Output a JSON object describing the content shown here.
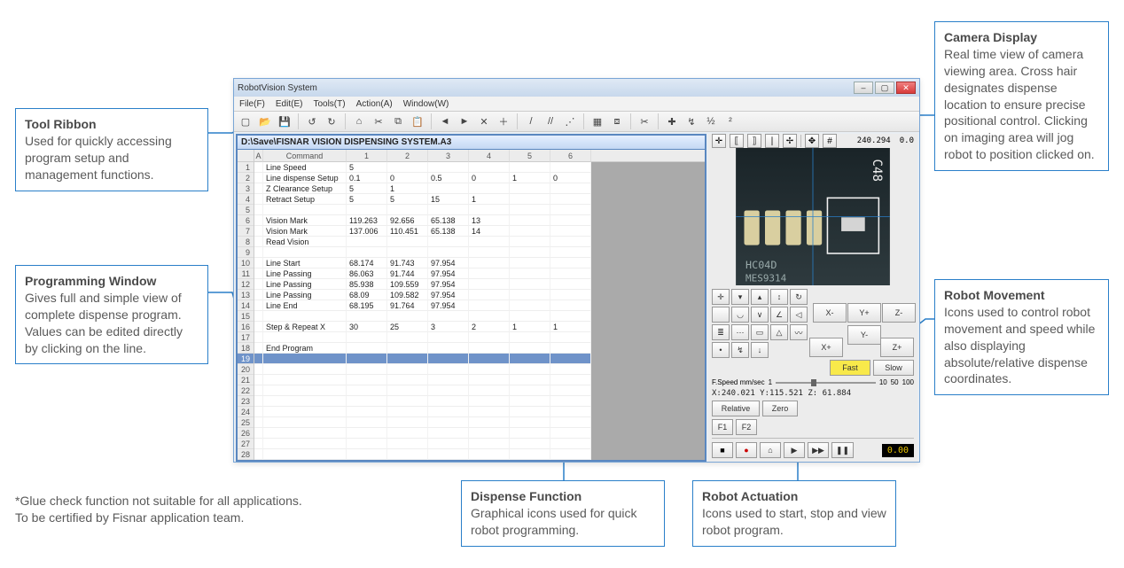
{
  "callouts": {
    "tool_ribbon": {
      "title": "Tool Ribbon",
      "body": "Used for quickly accessing program setup and management functions."
    },
    "programming_window": {
      "title": "Programming Window",
      "body": "Gives full and simple view of complete dispense program. Values can be edited directly by clicking on the line."
    },
    "camera_display": {
      "title": "Camera Display",
      "body": "Real time view of camera viewing area. Cross hair designates dispense location to ensure precise positional control. Clicking on imaging area will jog robot to position clicked on."
    },
    "robot_movement": {
      "title": "Robot Movement",
      "body": "Icons used to control robot movement and speed while also displaying absolute/relative dispense coordinates."
    },
    "dispense_function": {
      "title": "Dispense Function",
      "body": "Graphical icons used for quick robot programming."
    },
    "robot_actuation": {
      "title": "Robot Actuation",
      "body": "Icons used to start, stop and view robot program."
    }
  },
  "footnote": "*Glue check function not suitable for all applications. To be certified by Fisnar application team.",
  "app": {
    "title": "RobotVision System",
    "menus": [
      "File(F)",
      "Edit(E)",
      "Tools(T)",
      "Action(A)",
      "Window(W)"
    ],
    "ribbon_icons": [
      "new",
      "open",
      "save",
      "sep",
      "undo",
      "redo",
      "sep",
      "home",
      "cut",
      "copy",
      "paste",
      "sep",
      "arrow-left",
      "arrow-right",
      "close-x",
      "plus",
      "sep",
      "slash",
      "double-slash",
      "slash-nodes",
      "sep",
      "grid",
      "s-r",
      "sep",
      "scissors",
      "sep",
      "cross",
      "path",
      "1-2",
      "2-1"
    ],
    "topjog_icons": [
      "target",
      "bracket-in",
      "bracket-out",
      "divider",
      "crosshair",
      "sep",
      "xy-icon",
      "coord",
      "gap"
    ],
    "topjog_coord": "240.294",
    "topjog_extra": "0.0",
    "prog_title": "D:\\Save\\FISNAR VISION DISPENSING SYSTEM.A3",
    "grid": {
      "headers": [
        "A",
        "Command",
        "1",
        "2",
        "3",
        "4",
        "5",
        "6"
      ],
      "rows": [
        {
          "n": "1",
          "c": [
            "",
            "Line Speed",
            "5",
            "",
            "",
            "",
            "",
            ""
          ]
        },
        {
          "n": "2",
          "c": [
            "",
            "Line dispense Setup",
            "0.1",
            "0",
            "0.5",
            "0",
            "1",
            "0"
          ]
        },
        {
          "n": "3",
          "c": [
            "",
            "Z Clearance Setup",
            "5",
            "1",
            "",
            "",
            "",
            ""
          ]
        },
        {
          "n": "4",
          "c": [
            "",
            "Retract Setup",
            "5",
            "5",
            "15",
            "1",
            "",
            ""
          ]
        },
        {
          "n": "5",
          "c": [
            "",
            "",
            "",
            "",
            "",
            "",
            "",
            ""
          ]
        },
        {
          "n": "6",
          "c": [
            "",
            "Vision Mark",
            "119.263",
            "92.656",
            "65.138",
            "13",
            "",
            ""
          ]
        },
        {
          "n": "7",
          "c": [
            "",
            "Vision Mark",
            "137.006",
            "110.451",
            "65.138",
            "14",
            "",
            ""
          ]
        },
        {
          "n": "8",
          "c": [
            "",
            "Read Vision",
            "",
            "",
            "",
            "",
            "",
            ""
          ]
        },
        {
          "n": "9",
          "c": [
            "",
            "",
            "",
            "",
            "",
            "",
            "",
            ""
          ]
        },
        {
          "n": "10",
          "c": [
            "",
            "Line Start",
            "68.174",
            "91.743",
            "97.954",
            "",
            "",
            ""
          ]
        },
        {
          "n": "11",
          "c": [
            "",
            "Line Passing",
            "86.063",
            "91.744",
            "97.954",
            "",
            "",
            ""
          ]
        },
        {
          "n": "12",
          "c": [
            "",
            "Line Passing",
            "85.938",
            "109.559",
            "97.954",
            "",
            "",
            ""
          ]
        },
        {
          "n": "13",
          "c": [
            "",
            "Line Passing",
            "68.09",
            "109.582",
            "97.954",
            "",
            "",
            ""
          ]
        },
        {
          "n": "14",
          "c": [
            "",
            "Line End",
            "68.195",
            "91.764",
            "97.954",
            "",
            "",
            ""
          ]
        },
        {
          "n": "15",
          "c": [
            "",
            "",
            "",
            "",
            "",
            "",
            "",
            ""
          ]
        },
        {
          "n": "16",
          "c": [
            "",
            "Step & Repeat X",
            "30",
            "25",
            "3",
            "2",
            "1",
            "1"
          ]
        },
        {
          "n": "17",
          "c": [
            "",
            "",
            "",
            "",
            "",
            "",
            "",
            ""
          ]
        },
        {
          "n": "18",
          "c": [
            "",
            "End Program",
            "",
            "",
            "",
            "",
            "",
            ""
          ]
        }
      ],
      "selected_row": "19",
      "extra_rows": 18
    },
    "jog": {
      "grid_icons": [
        "target",
        "v-down",
        "u-up",
        "v-arr",
        "tri-cw",
        " ",
        "arc",
        "v2",
        "ang",
        "tri-l",
        "lines",
        "dots",
        "box",
        "tri-n",
        "trace",
        "dot",
        "path",
        "down"
      ],
      "axis_btns": [
        "X-",
        "Y+",
        "X+",
        "Z-",
        "Y-",
        "Z+"
      ],
      "speed_labels": [
        "Fast",
        "Slow"
      ],
      "slider": {
        "label": "F.Speed mm/sec",
        "ticks": [
          "1",
          "10",
          "50",
          "100"
        ],
        "pos": 0.35
      },
      "coords": "X:240.021  Y:115.521  Z: 61.884",
      "rel_abs": [
        "Relative",
        "Zero"
      ],
      "f_buttons": [
        "F1",
        "F2"
      ],
      "actuation_icons": [
        "stop",
        "rec",
        "home",
        "play",
        "play-fast",
        "pause"
      ],
      "timer": "0.00"
    },
    "camera_label": "C48",
    "camera_label2": "HC04D",
    "camera_label3": "MES9314"
  }
}
